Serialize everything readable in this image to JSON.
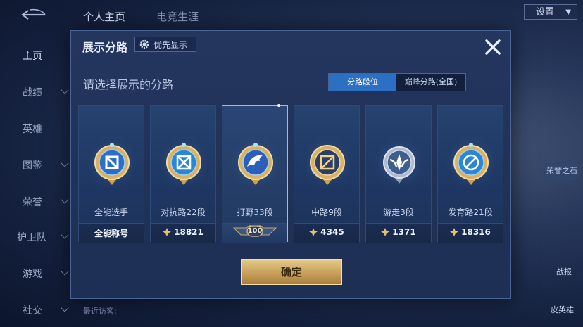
{
  "topnav": {
    "tabs": [
      "个人主页",
      "电竞生涯"
    ],
    "settings_label": "设置"
  },
  "sidebar": {
    "items": [
      {
        "label": "主页",
        "active": true,
        "chevron": false
      },
      {
        "label": "战绩",
        "active": false,
        "chevron": true
      },
      {
        "label": "英雄",
        "active": false,
        "chevron": false
      },
      {
        "label": "图鉴",
        "active": false,
        "chevron": true
      },
      {
        "label": "荣誉",
        "active": false,
        "chevron": true
      },
      {
        "label": "护卫队",
        "active": false,
        "chevron": true
      },
      {
        "label": "游戏",
        "active": false,
        "chevron": true
      },
      {
        "label": "社交",
        "active": false,
        "chevron": true
      }
    ]
  },
  "recent_visitors_label": "最近访客:",
  "right_panel": {
    "chip_label": "荣誉之石",
    "label_1": "战报",
    "label_2": "皮英雄"
  },
  "dialog": {
    "title": "展示分路",
    "priority_label": "优先显示",
    "subtitle": "请选择展示的分路",
    "segment": {
      "active": "分路段位",
      "inactive": "巅峰分路(全国)"
    },
    "confirm_label": "确定",
    "cards": [
      {
        "name": "全能选手",
        "stat": "全能称号",
        "has_coin": false,
        "selected": false,
        "emblem": "all-round-emblem-icon"
      },
      {
        "name": "对抗路22段",
        "stat": "18821",
        "has_coin": true,
        "selected": false,
        "emblem": "clash-lane-emblem-icon"
      },
      {
        "name": "打野33段",
        "stat": "100",
        "has_coin": false,
        "selected": true,
        "emblem": "jungle-emblem-icon"
      },
      {
        "name": "中路9段",
        "stat": "4345",
        "has_coin": true,
        "selected": false,
        "emblem": "mid-lane-emblem-icon"
      },
      {
        "name": "游走3段",
        "stat": "1371",
        "has_coin": true,
        "selected": false,
        "emblem": "roam-emblem-icon"
      },
      {
        "name": "发育路21段",
        "stat": "18316",
        "has_coin": true,
        "selected": false,
        "emblem": "farm-lane-emblem-icon"
      }
    ]
  },
  "colors": {
    "accent_blue": "#2d6fc3",
    "gold": "#d4b477",
    "panel": "#1e2f54"
  }
}
